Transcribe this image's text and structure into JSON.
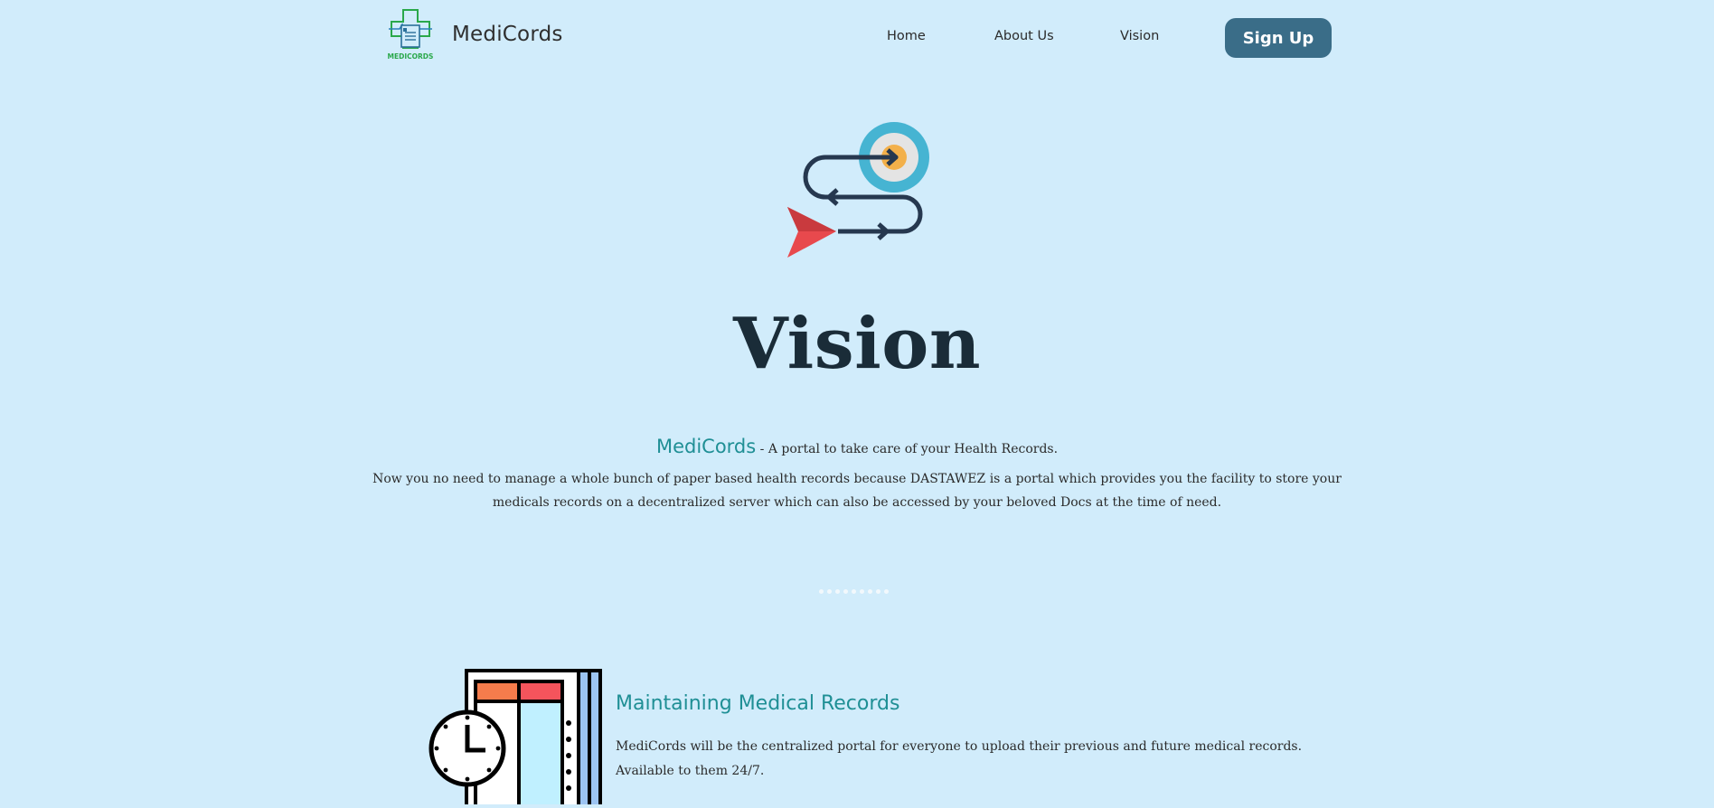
{
  "nav": {
    "logo_text": "MEDICORDS",
    "brand": "MediCords",
    "links": [
      {
        "label": "Home"
      },
      {
        "label": "About Us"
      },
      {
        "label": "Vision"
      }
    ],
    "signup_label": "Sign Up"
  },
  "hero": {
    "icon": "target-arrow-icon",
    "title": "Vision"
  },
  "intro": {
    "brand": "MediCords",
    "tagline": " - A portal to take care of your Health Records.",
    "description": "Now you no need to manage a whole bunch of paper based health records because DASTAWEZ is a portal which provides you the facility to store your medicals records on a decentralized server which can also be accessed by your beloved Docs at the time of need."
  },
  "divider": {
    "dot_count": 9
  },
  "feature": {
    "icon": "records-clock-icon",
    "title": "Maintaining Medical Records",
    "line1": "MediCords will be the centralized portal for everyone to upload their previous and future medical records.",
    "line2": "Available to them 24/7."
  },
  "colors": {
    "background": "#d1ecfb",
    "accent": "#1f8f95",
    "button": "#3a6d88",
    "title": "#1a2c38"
  }
}
